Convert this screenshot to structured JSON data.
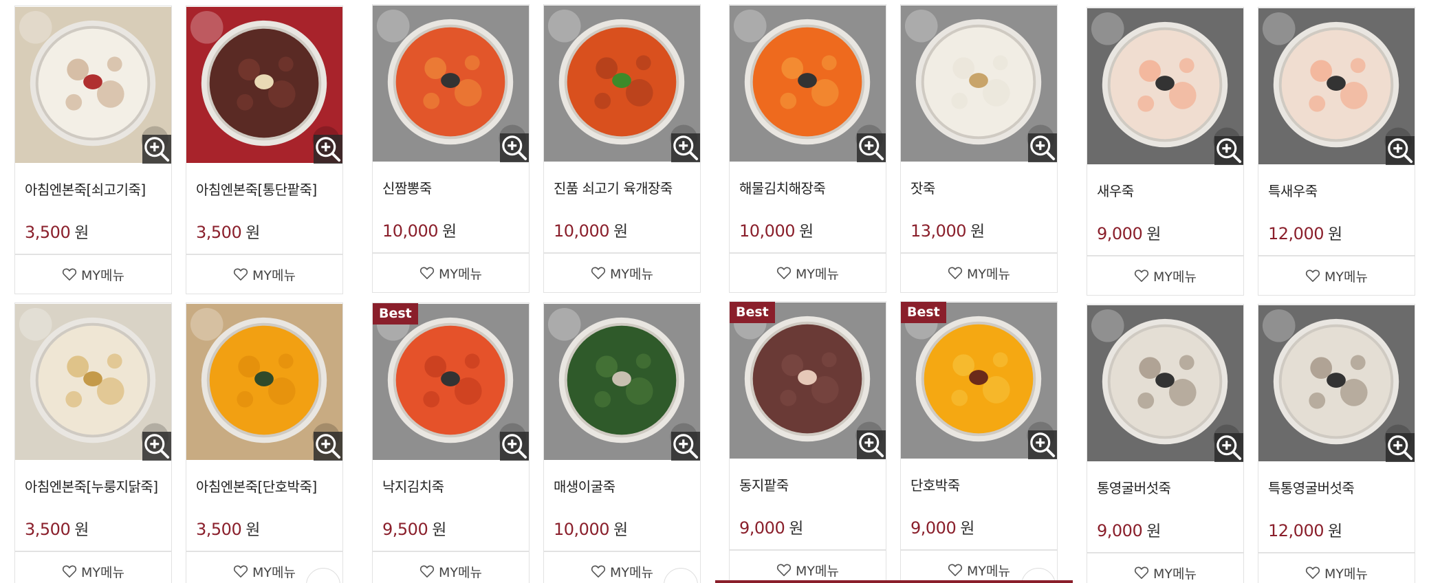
{
  "currency_unit": "원",
  "my_menu_label": "MY메뉴",
  "best_label": "Best",
  "products": [
    {
      "name": "아침엔본죽[쇠고기죽]",
      "price": "3,500",
      "best": false,
      "bowl": "#f3efe6",
      "bowl2": "#c9a98a",
      "bg": "#d8cdb8",
      "garnish": "#b03030"
    },
    {
      "name": "아침엔본죽[통단팥죽]",
      "price": "3,500",
      "best": false,
      "bowl": "#5a2a24",
      "bowl2": "#7a3a30",
      "bg": "#a8232b",
      "garnish": "#e9d9b5"
    },
    {
      "name": "신짬뽕죽",
      "price": "10,000",
      "best": false,
      "bowl": "#e2562a",
      "bowl2": "#f08a3a",
      "bg": "#8f8f8f",
      "garnish": "#333333"
    },
    {
      "name": "진품 쇠고기 육개장죽",
      "price": "10,000",
      "best": false,
      "bowl": "#d9501e",
      "bowl2": "#a83a1a",
      "bg": "#8f8f8f",
      "garnish": "#3d8a2a"
    },
    {
      "name": "해물김치해장죽",
      "price": "10,000",
      "best": false,
      "bowl": "#ee6a1e",
      "bowl2": "#f59a3a",
      "bg": "#8f8f8f",
      "garnish": "#333333"
    },
    {
      "name": "잣죽",
      "price": "13,000",
      "best": false,
      "bowl": "#f1ede4",
      "bowl2": "#e9e4d8",
      "bg": "#8f8f8f",
      "garnish": "#c8a46a"
    },
    {
      "name": "새우죽",
      "price": "9,000",
      "best": false,
      "bowl": "#f0ddd0",
      "bowl2": "#f3a889",
      "bg": "#6b6b6b",
      "garnish": "#333333"
    },
    {
      "name": "특새우죽",
      "price": "12,000",
      "best": false,
      "bowl": "#f0ddd0",
      "bowl2": "#f3a889",
      "bg": "#6b6b6b",
      "garnish": "#333333"
    },
    {
      "name": "아침엔본죽[누룽지닭죽]",
      "price": "3,500",
      "best": false,
      "bowl": "#efe6d4",
      "bowl2": "#d8b46a",
      "bg": "#d9d3c6",
      "garnish": "#c49a4a"
    },
    {
      "name": "아침엔본죽[단호박죽]",
      "price": "3,500",
      "best": false,
      "bowl": "#f2a012",
      "bowl2": "#e08a0a",
      "bg": "#c8ab82",
      "garnish": "#2f4a2a"
    },
    {
      "name": "낙지김치죽",
      "price": "9,500",
      "best": true,
      "bowl": "#e5522a",
      "bowl2": "#c23b1d",
      "bg": "#8f8f8f",
      "garnish": "#333333"
    },
    {
      "name": "매생이굴죽",
      "price": "10,000",
      "best": false,
      "bowl": "#2f5a2a",
      "bowl2": "#4c7a3a",
      "bg": "#8f8f8f",
      "garnish": "#c8c0b0"
    },
    {
      "name": "동지팥죽",
      "price": "9,000",
      "best": true,
      "bowl": "#6a3a36",
      "bowl2": "#7d4a44",
      "bg": "#8f8f8f",
      "garnish": "#e6c8b8"
    },
    {
      "name": "단호박죽",
      "price": "9,000",
      "best": true,
      "bowl": "#f5a812",
      "bowl2": "#f7c23a",
      "bg": "#8f8f8f",
      "garnish": "#6b2a1a"
    },
    {
      "name": "통영굴버섯죽",
      "price": "9,000",
      "best": false,
      "bowl": "#e4ded4",
      "bowl2": "#9a8a7a",
      "bg": "#6b6b6b",
      "garnish": "#333333"
    },
    {
      "name": "특통영굴버섯죽",
      "price": "12,000",
      "best": false,
      "bowl": "#e4ded4",
      "bowl2": "#9a8a7a",
      "bg": "#6b6b6b",
      "garnish": "#333333"
    }
  ]
}
